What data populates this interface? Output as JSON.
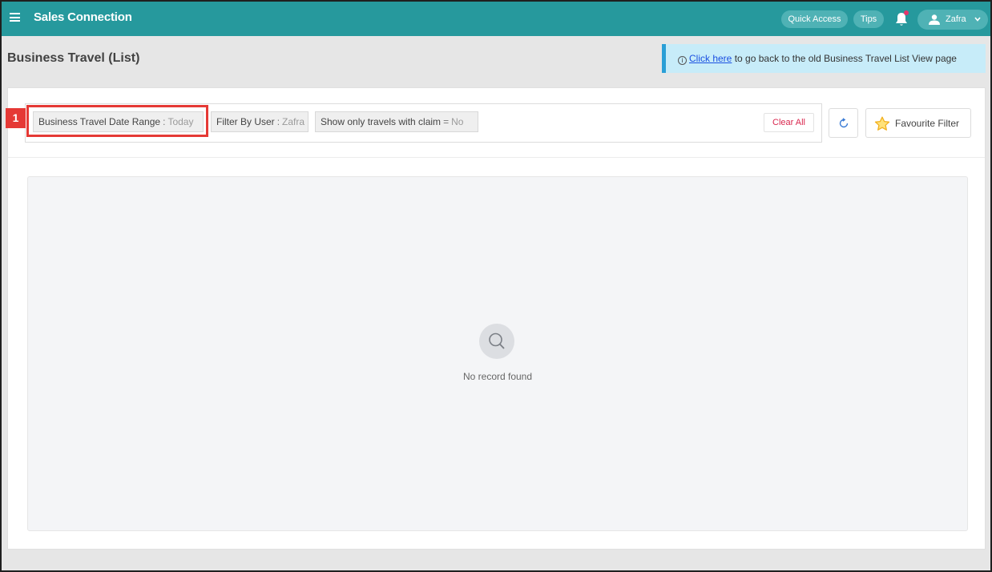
{
  "header": {
    "app_title": "Sales Connection",
    "quick_access_label": "Quick Access",
    "tips_label": "Tips",
    "user_name": "Zafra",
    "accent_color": "#26999d",
    "notification_dot_color": "#e5366b"
  },
  "page": {
    "title": "Business Travel (List)"
  },
  "info_banner": {
    "icon": "info-circle-icon",
    "link_text": "Click here",
    "text": " to go back to the old Business Travel List View page"
  },
  "filters": {
    "chips": [
      {
        "label": "Business Travel Date Range",
        "separator": ":",
        "value": "Today"
      },
      {
        "label": "Filter By User",
        "separator": ":",
        "value": "Zafra"
      },
      {
        "label": "Show only travels with claim",
        "separator": "=",
        "value": "No"
      }
    ],
    "clear_all_label": "Clear All",
    "favourite_label": "Favourite Filter",
    "annotation_number": "1"
  },
  "results": {
    "empty_text": "No record found"
  }
}
